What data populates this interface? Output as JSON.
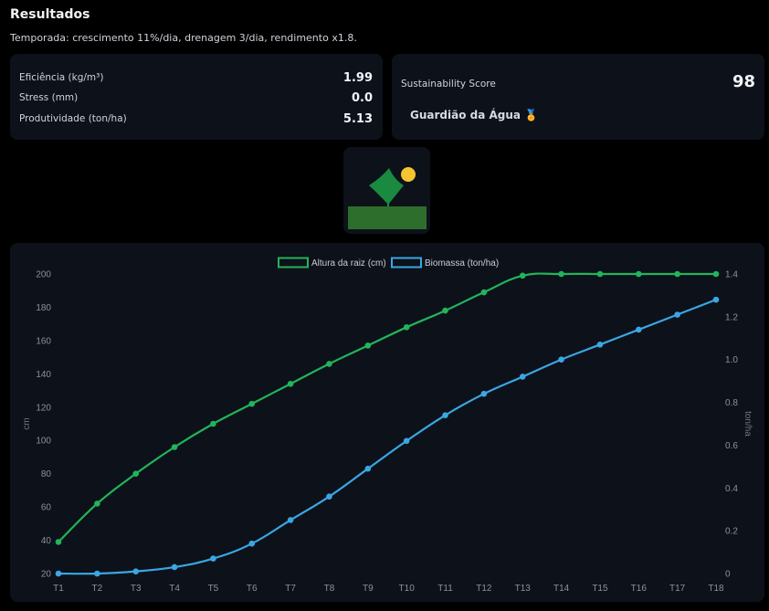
{
  "header": {
    "title": "Resultados",
    "subtitle": "Temporada: crescimento 11%/dia, drenagem 3/dia, rendimento x1.8."
  },
  "metrics": [
    {
      "label": "Eficiência (kg/m³)",
      "value": "1.99"
    },
    {
      "label": "Stress (mm)",
      "value": "0.0"
    },
    {
      "label": "Produtividade (ton/ha)",
      "value": "5.13"
    }
  ],
  "score": {
    "label": "Sustainability Score",
    "value": "98",
    "badge": "Guardião da Água 🏅"
  },
  "colors": {
    "root": "#22b45a",
    "biomass": "#3aa7e3",
    "sun": "#f5c431",
    "leaf": "#198a3f",
    "soil": "#2e6e2c"
  },
  "chart_data": {
    "type": "line",
    "categories": [
      "T1",
      "T2",
      "T3",
      "T4",
      "T5",
      "T6",
      "T7",
      "T8",
      "T9",
      "T10",
      "T11",
      "T12",
      "T13",
      "T14",
      "T15",
      "T16",
      "T17",
      "T18"
    ],
    "series": [
      {
        "name": "Altura da raiz (cm)",
        "axis": "left",
        "color": "#22b45a",
        "values": [
          39,
          62,
          80,
          96,
          110,
          122,
          134,
          146,
          157,
          168,
          178,
          189,
          199,
          200,
          200,
          200,
          200,
          200
        ]
      },
      {
        "name": "Biomassa (ton/ha)",
        "axis": "right",
        "color": "#3aa7e3",
        "values": [
          0.0,
          0.0,
          0.01,
          0.03,
          0.07,
          0.14,
          0.25,
          0.36,
          0.49,
          0.62,
          0.74,
          0.84,
          0.92,
          1.0,
          1.07,
          1.14,
          1.21,
          1.28
        ]
      }
    ],
    "ylabel": "cm",
    "y2label": "ton/ha",
    "ylim": [
      20,
      200
    ],
    "yticks": [
      20,
      40,
      60,
      80,
      100,
      120,
      140,
      160,
      180,
      200
    ],
    "y2lim": [
      0,
      1.4
    ],
    "y2ticks": [
      "0",
      "0.2",
      "0.4",
      "0.6",
      "0.8",
      "1.0",
      "1.2",
      "1.4"
    ],
    "legend": "top-center",
    "grid": false
  }
}
